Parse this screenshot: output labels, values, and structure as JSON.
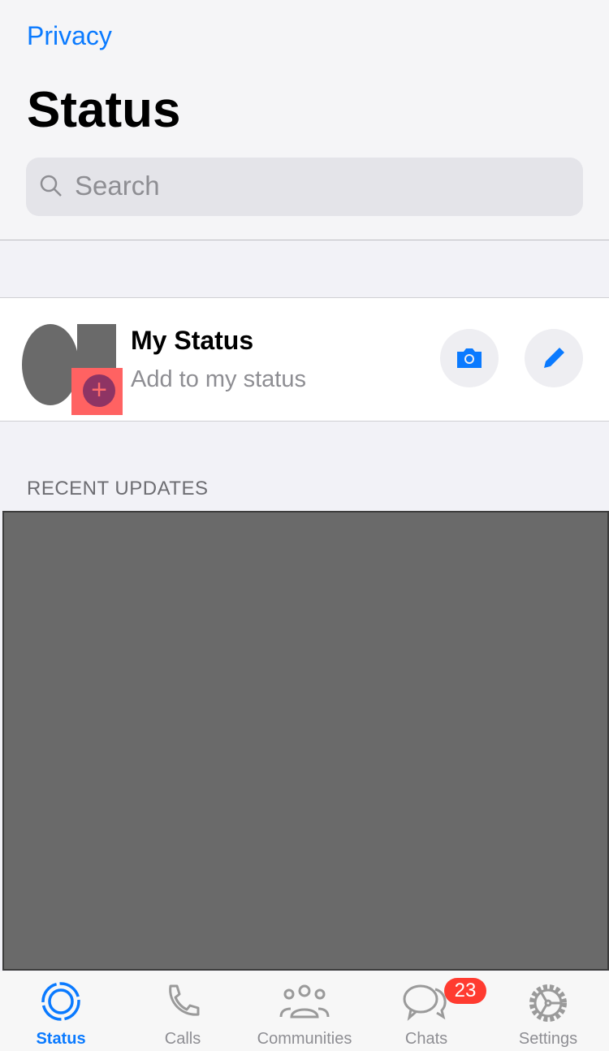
{
  "header": {
    "back_link": "Privacy",
    "title": "Status",
    "search_placeholder": "Search"
  },
  "my_status": {
    "name": "My Status",
    "subtitle": "Add to my status",
    "actions": [
      "camera-icon",
      "pencil-icon"
    ]
  },
  "recent_updates": {
    "heading": "RECENT UPDATES"
  },
  "tabbar": {
    "tabs": [
      {
        "label": "Status",
        "icon": "status-icon",
        "active": true
      },
      {
        "label": "Calls",
        "icon": "phone-icon"
      },
      {
        "label": "Communities",
        "icon": "communities-icon"
      },
      {
        "label": "Chats",
        "icon": "chats-icon",
        "badge": "23"
      },
      {
        "label": "Settings",
        "icon": "gear-icon"
      }
    ]
  },
  "colors": {
    "accent": "#0a7aff",
    "badge": "#ff3b30"
  }
}
